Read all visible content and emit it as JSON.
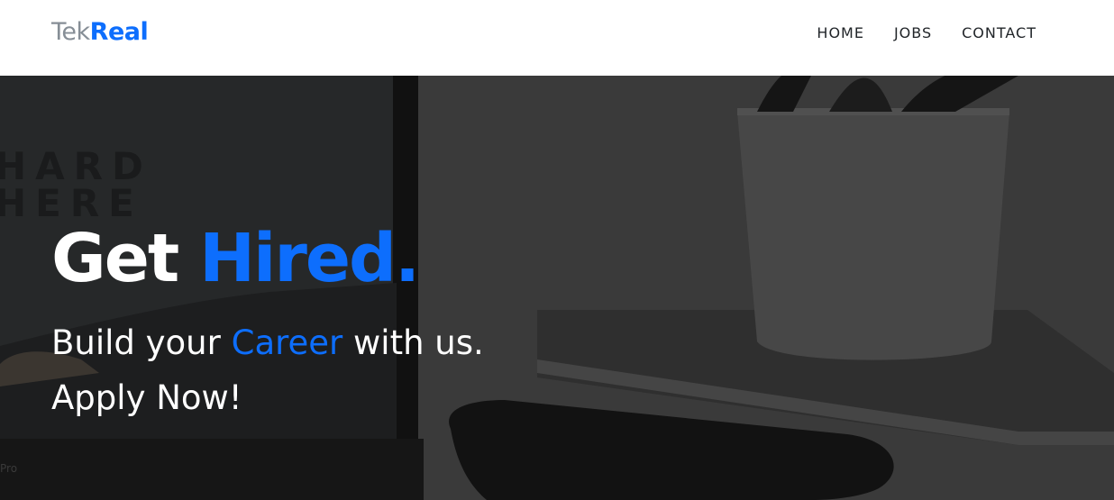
{
  "brand": {
    "part1": "Tek",
    "part2": "Real",
    "color_part1": "#868e96",
    "color_part2": "#0d6efd"
  },
  "nav": {
    "items": [
      {
        "label": "HOME"
      },
      {
        "label": "JOBS"
      },
      {
        "label": "CONTACT"
      }
    ]
  },
  "hero": {
    "title_part1": "Get ",
    "title_accent": "Hired.",
    "subtitle_part1": "Build your ",
    "subtitle_accent": "Career",
    "subtitle_part2": " with us.",
    "apply": "Apply Now!",
    "accent_color": "#0d6efd",
    "background_poster_text": [
      "HARD",
      "HERE"
    ],
    "background_laptop_text": "Pro"
  }
}
